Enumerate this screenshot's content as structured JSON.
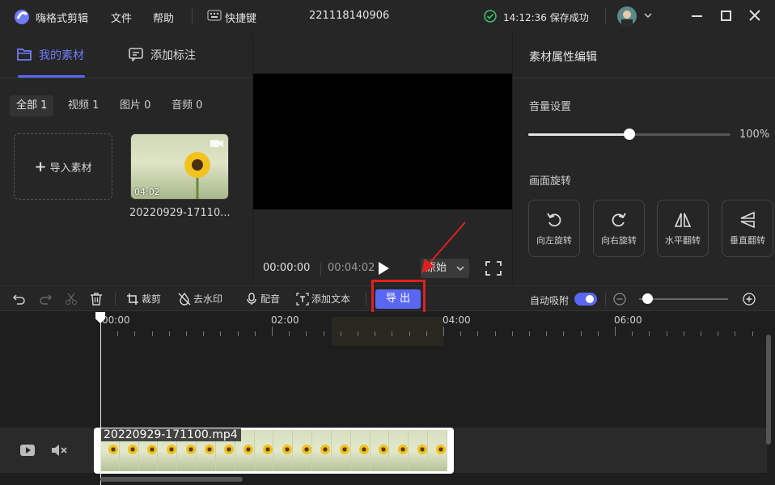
{
  "titlebar": {
    "app_name": "嗨格式剪辑",
    "menu_file": "文件",
    "menu_help": "帮助",
    "shortcut_label": "快捷键",
    "project_name": "221118140906",
    "save_status": "14:12:36 保存成功"
  },
  "left_panel": {
    "tab_materials": "我的素材",
    "tab_annotations": "添加标注",
    "filters": [
      "全部 1",
      "视频 1",
      "图片 0",
      "音频 0"
    ],
    "import_label": "导入素材",
    "media_item": {
      "duration": "04:02",
      "name": "20220929-17110..."
    }
  },
  "preview": {
    "current_time": "00:00:00",
    "total_time": "00:04:02",
    "ratio": "原始"
  },
  "right_panel": {
    "title": "素材属性编辑",
    "volume_label": "音量设置",
    "volume_value": "100%",
    "volume_fraction": 0.5,
    "rotation_label": "画面旋转",
    "rotate_left": "向左旋转",
    "rotate_right": "向右旋转",
    "flip_horizontal": "水平翻转",
    "flip_vertical": "垂直翻转"
  },
  "toolbar": {
    "crop": "裁剪",
    "watermark": "去水印",
    "dub": "配音",
    "add_text": "添加文本",
    "export": "导 出",
    "auto_snap": "自动吸附"
  },
  "timeline": {
    "ruler": [
      "00:00",
      "02:00",
      "04:00",
      "06:00"
    ],
    "clip_name": "20220929-171100.mp4"
  },
  "colors": {
    "accent": "#5a67f2",
    "highlight": "#e02020"
  }
}
